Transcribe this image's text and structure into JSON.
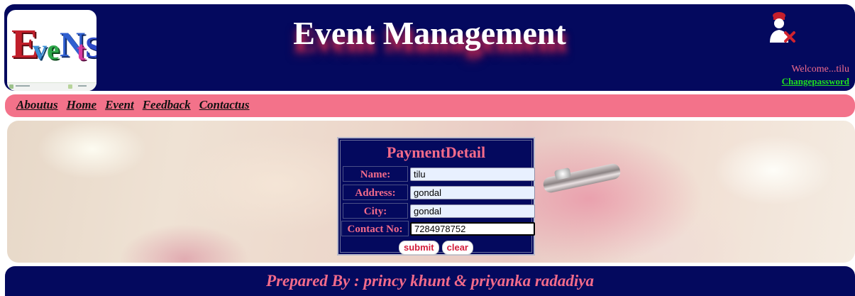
{
  "header": {
    "logo_text": "EveNtS",
    "title": "Event Management",
    "welcome": "Welcome...tilu",
    "change_password": "Changepassword"
  },
  "nav": {
    "items": [
      {
        "label": "Aboutus"
      },
      {
        "label": "Home"
      },
      {
        "label": "Event"
      },
      {
        "label": "Feedback"
      },
      {
        "label": "Contactus"
      }
    ]
  },
  "payment_form": {
    "title": "PaymentDetail",
    "fields": [
      {
        "label": "Name:",
        "value": "tilu"
      },
      {
        "label": "Address:",
        "value": "gondal"
      },
      {
        "label": "City:",
        "value": "gondal"
      },
      {
        "label": "Contact No:",
        "value": "7284978752"
      }
    ],
    "submit_label": "submit",
    "clear_label": "clear"
  },
  "footer": {
    "text": "Prepared By : princy khunt & priyanka radadiya"
  },
  "colors": {
    "header_bg": "#04095e",
    "nav_bg": "#f3728a",
    "accent_pink": "#f36b8a",
    "link_green": "#1fe01f",
    "button_text": "#d31d3a"
  },
  "icons": {
    "user": "user-remove-icon",
    "logo": "events-logo"
  }
}
